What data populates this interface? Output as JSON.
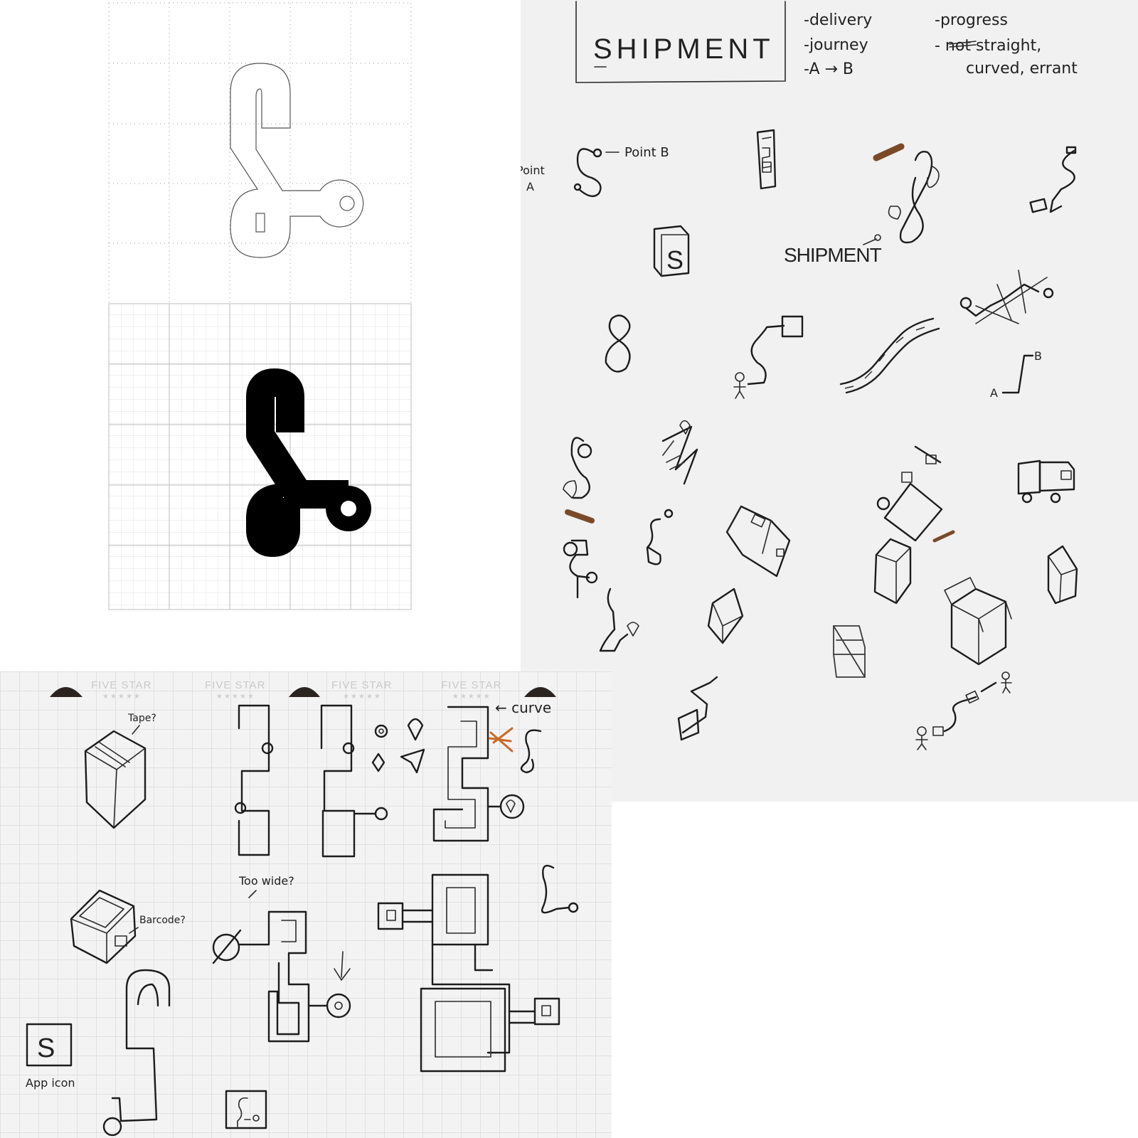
{
  "sketch_page": {
    "title_box": {
      "title": "SHIPMENT"
    },
    "keywords_left": [
      "-delivery",
      "-journey",
      "-A → B"
    ],
    "keywords_right": [
      "-progress",
      "- not straight,",
      "curved, errant"
    ],
    "annotations": {
      "point_b": "Point B",
      "point_a_line1": "Point",
      "point_a_line2": "A",
      "wordmark": "SHIPMENT",
      "a_label": "A",
      "b_label": "B",
      "box_letter": "S"
    }
  },
  "notebook": {
    "header_labels": [
      "FIVE STAR",
      "FIVE STAR",
      "FIVE STAR",
      "FIVE STAR"
    ],
    "header_stars": [
      "★★★★★",
      "★★★★★",
      "★★★★★",
      "★★★★★"
    ],
    "annotations": {
      "tape": "Tape?",
      "barcode": "Barcode?",
      "too_wide": "Too wide?",
      "curve": "← curve",
      "app_icon": "App icon",
      "app_icon_letter": "S"
    }
  },
  "colors": {
    "logo_black": "#000000",
    "paper_grey": "#f1f1f1",
    "marker_brown": "#7a4a28",
    "marker_orange": "#c86a2a"
  }
}
